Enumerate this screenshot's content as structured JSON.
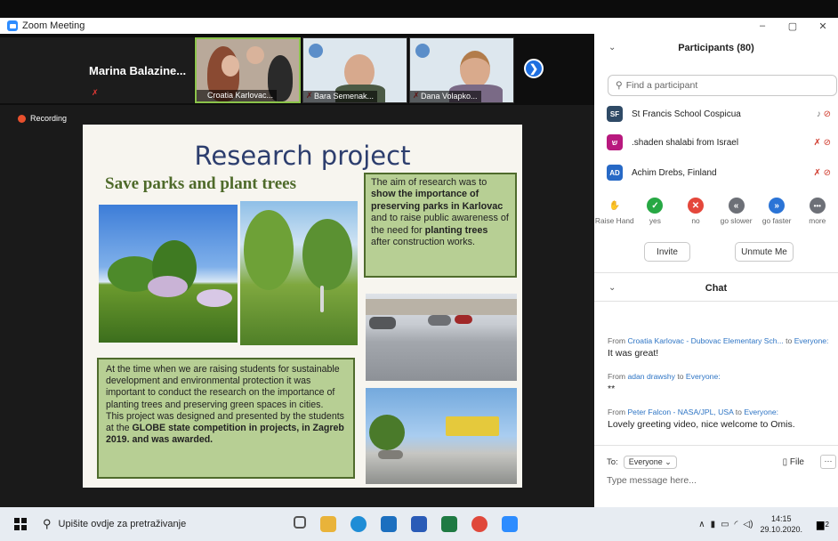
{
  "window": {
    "title": "Zoom Meeting",
    "controls": [
      "–",
      "▢",
      "✕"
    ]
  },
  "speaker": {
    "name": "Marina  Balazine..."
  },
  "tiles": [
    {
      "caption": "Croatia Karlovac..."
    },
    {
      "caption": "Bara Semenak..."
    },
    {
      "caption": "Dana Volapko..."
    }
  ],
  "recording": {
    "label": "Recording"
  },
  "slide": {
    "title": "Research project",
    "subtitle": "Save parks and plant trees",
    "box1": {
      "t1": "The aim of research was to ",
      "b1": "show the importance of preserving parks in Karlovac",
      "t2": " and to raise public awareness of the need for ",
      "b2": "planting trees",
      "t3": " after construction works."
    },
    "box2": {
      "p1": "At the time when we are raising students for sustainable development and environmental protection it was important to conduct the research on the importance of planting trees and preserving green spaces in cities.",
      "p2a": "This project was designed and presented by the students at the ",
      "p2b": "GLOBE state competition in projects, in Zagreb 2019. and was awarded."
    }
  },
  "participants": {
    "header": "Participants (80)",
    "search_placeholder": "Find a participant",
    "list": [
      {
        "initials": "SF",
        "name": "St Francis School Cospicua",
        "color": "#2f4a66"
      },
      {
        "initials": "ש",
        "name": ".shaden shalabi from Israel",
        "color": "#b8197e"
      },
      {
        "initials": "AD",
        "name": "Achim Drebs, Finland",
        "color": "#2769c6"
      }
    ],
    "reactions": [
      {
        "label": "Raise Hand",
        "icon": "✋",
        "color": "#2b74d6"
      },
      {
        "label": "yes",
        "icon": "✓",
        "color": "#27a844"
      },
      {
        "label": "no",
        "icon": "✕",
        "color": "#e4473b"
      },
      {
        "label": "go slower",
        "icon": "«",
        "color": "#6d7077"
      },
      {
        "label": "go faster",
        "icon": "»",
        "color": "#2b74d6"
      },
      {
        "label": "more",
        "icon": "•••",
        "color": "#6d7077"
      }
    ],
    "invite_label": "Invite",
    "unmute_label": "Unmute Me"
  },
  "chat": {
    "header": "Chat",
    "to_word": "to",
    "messages": [
      {
        "from": "From",
        "sender": "Croatia Karlovac - Dubovac Elementary Sch...",
        "to": "Everyone:",
        "text": "It was great!"
      },
      {
        "from": "From",
        "sender": "adan drawshy",
        "to": "Everyone:",
        "text": "**"
      },
      {
        "from": "From",
        "sender": "Peter Falcon - NASA/JPL, USA",
        "to": "Everyone:",
        "text": "Lovely greeting video, nice welcome to Omis."
      }
    ],
    "to_label": "To:",
    "recipient": "Everyone ⌄",
    "file_label": "File",
    "more_label": "···",
    "input_placeholder": "Type message here..."
  },
  "taskbar": {
    "search_text": "Upišite ovdje za pretraživanje",
    "time": "14:15",
    "date": "29.10.2020.",
    "notifications": "2"
  }
}
